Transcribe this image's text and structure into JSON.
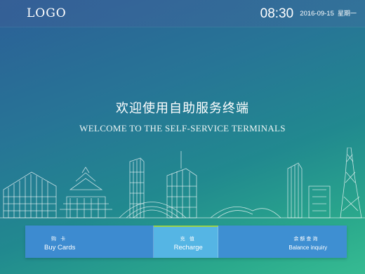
{
  "header": {
    "logo": "LOGO",
    "time": "08:30",
    "date": "2016-09-15",
    "weekday": "星期一"
  },
  "welcome": {
    "title_cn": "欢迎使用自助服务终端",
    "title_en": "WELCOME TO THE SELF-SERVICE TERMINALS"
  },
  "menu": {
    "items": [
      {
        "label_cn": "购 卡",
        "label_en": "Buy Cards",
        "selected": false
      },
      {
        "label_cn": "充 值",
        "label_en": "Recharge",
        "selected": true
      },
      {
        "label_cn": "余额查询",
        "label_en": "Balance inquiry",
        "selected": false
      }
    ]
  },
  "colors": {
    "background_top": "#2c5f97",
    "background_bottom": "#36bb92",
    "menu_bar": "#3e8fd2",
    "menu_selected": "#55b5e4",
    "selected_indicator": "#9bd24a"
  }
}
